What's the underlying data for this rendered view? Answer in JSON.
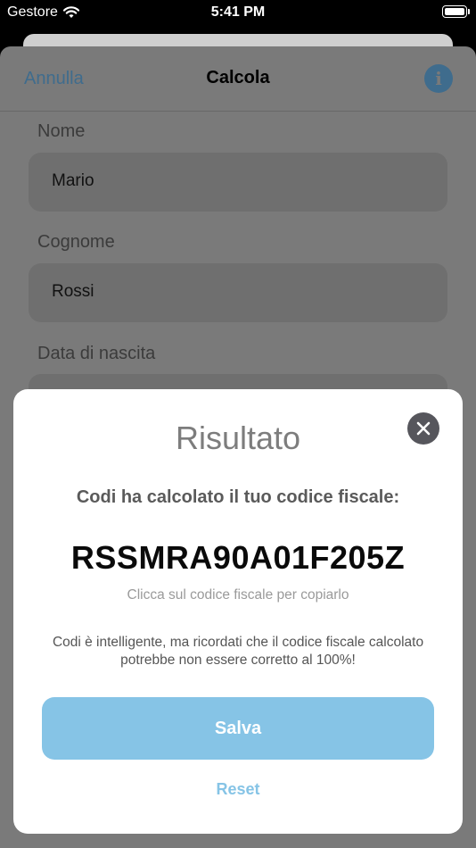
{
  "status_bar": {
    "carrier": "Gestore",
    "time": "5:41 PM"
  },
  "nav": {
    "cancel_label": "Annulla",
    "title": "Calcola",
    "info_icon": "info-icon"
  },
  "form": {
    "name_label": "Nome",
    "name_value": "Mario",
    "surname_label": "Cognome",
    "surname_value": "Rossi",
    "birthdate_label": "Data di nascita"
  },
  "result": {
    "title": "Risultato",
    "subtitle": "Codi ha calcolato il tuo codice fiscale:",
    "code": "RSSMRA90A01F205Z",
    "copy_hint": "Clicca sul codice fiscale per copiarlo",
    "disclaimer": "Codi è intelligente, ma ricordati che il codice fiscale calcolato potrebbe non essere corretto al 100%!",
    "save_label": "Salva",
    "reset_label": "Reset"
  },
  "colors": {
    "accent": "#86c4e6",
    "overlay_gray": "#7a7a7a",
    "close_button": "#56565c"
  }
}
